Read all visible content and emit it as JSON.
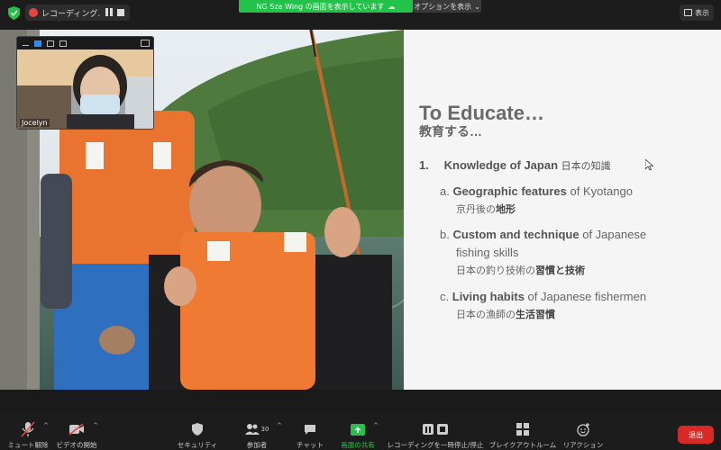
{
  "topbar": {
    "recording_label": "レコーディング...",
    "share_banner": "NG Sze Wing の画面を表示しています",
    "options_label": "オプションを表示",
    "view_label": "表示"
  },
  "selfview": {
    "name": "Jocelyn"
  },
  "slide": {
    "title": "To Educate…",
    "subtitle": "教育する…",
    "item1": {
      "num": "1.",
      "bold": "Knowledge of Japan",
      "jp": "日本の知識"
    },
    "items": [
      {
        "letter": "a.",
        "bold": "Geographic features",
        "rest": "of Kyotango",
        "line2": "",
        "jp_pre": "京丹後の",
        "jp_bold": "地形"
      },
      {
        "letter": "b.",
        "bold": "Custom and technique",
        "rest": "of Japanese",
        "line2": "fishing skills",
        "jp_pre": "日本の釣り技術の",
        "jp_bold": "習慣と技術"
      },
      {
        "letter": "c.",
        "bold": "Living habits",
        "rest": "of Japanese fishermen",
        "line2": "",
        "jp_pre": "日本の漁師の",
        "jp_bold": "生活習慣"
      }
    ]
  },
  "toolbar": {
    "unmute": "ミュート解除",
    "start_video": "ビデオの開始",
    "security": "セキュリティ",
    "participants": "参加者",
    "participants_count": "30",
    "chat": "チャット",
    "share_screen": "画面の共有",
    "recording": "レコーディングを一時停止/停止",
    "breakout": "ブレイクアウトルーム",
    "reactions": "リアクション",
    "leave": "退出"
  },
  "colors": {
    "share_green": "#23c34a",
    "leave_red": "#d92a27",
    "accent_blue": "#2d8cff",
    "record_red": "#e5453b"
  }
}
